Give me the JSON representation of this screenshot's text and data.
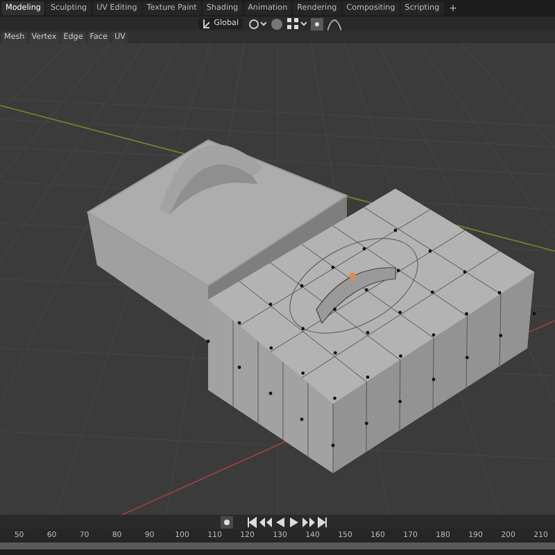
{
  "workspace_tabs": [
    {
      "label": "Modeling",
      "selected": true
    },
    {
      "label": "Sculpting",
      "selected": false
    },
    {
      "label": "UV Editing",
      "selected": false
    },
    {
      "label": "Texture Paint",
      "selected": false
    },
    {
      "label": "Shading",
      "selected": false
    },
    {
      "label": "Animation",
      "selected": false
    },
    {
      "label": "Rendering",
      "selected": false
    },
    {
      "label": "Compositing",
      "selected": false
    },
    {
      "label": "Scripting",
      "selected": false
    }
  ],
  "add_tab": "+",
  "header": {
    "orientation": "Global"
  },
  "menus": [
    "Mesh",
    "Vertex",
    "Edge",
    "Face",
    "UV"
  ],
  "timeline": {
    "frames": [
      "50",
      "60",
      "70",
      "80",
      "90",
      "100",
      "110",
      "120",
      "130",
      "140",
      "150",
      "160",
      "170",
      "180",
      "190",
      "200",
      "210"
    ]
  }
}
